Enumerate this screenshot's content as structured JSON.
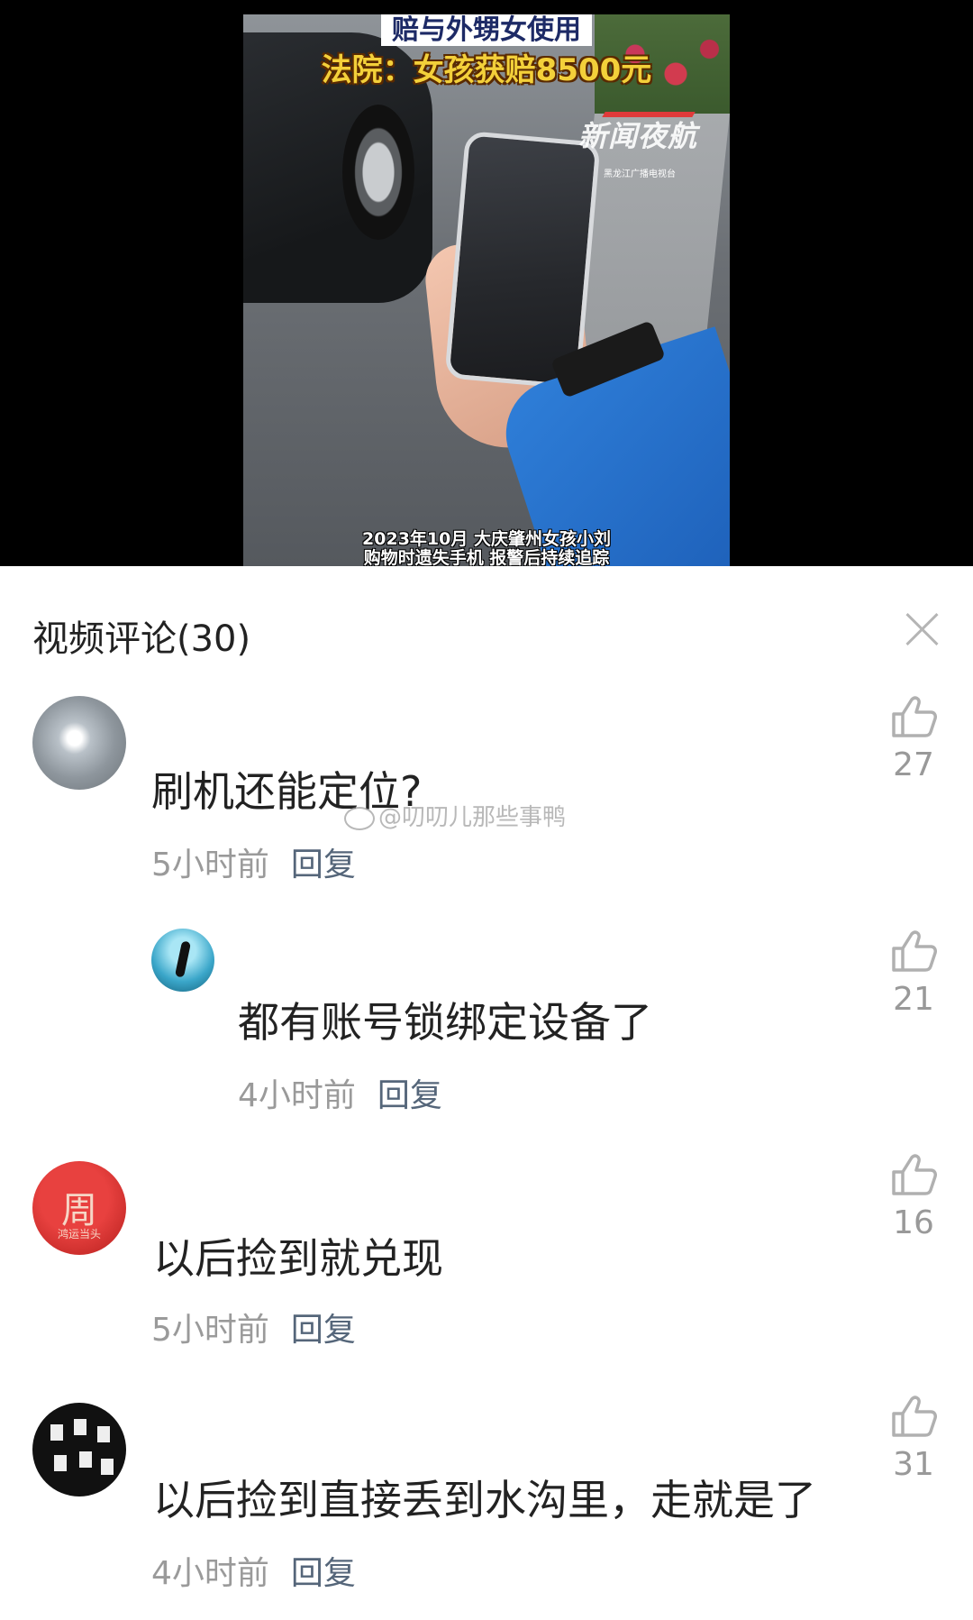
{
  "video": {
    "headline_top": "赔与外甥女使用",
    "headline_main": "法院：女孩获赔8500元",
    "logo": "新闻夜航",
    "logo_small": "黑龙江广播电视台",
    "caption_line1": "2023年10月 大庆肇州女孩小刘",
    "caption_line2": "购物时遗失手机 报警后持续追踪"
  },
  "comments_header": {
    "title": "视频评论(30)"
  },
  "watermark": "@叨叨儿那些事鸭",
  "comments": [
    {
      "text": "刷机还能定位?",
      "time": "5小时前",
      "reply": "回复",
      "likes": "27"
    },
    {
      "text": "都有账号锁绑定设备了",
      "time": "4小时前",
      "reply": "回复",
      "likes": "21"
    },
    {
      "text": "以后捡到就兑现",
      "time": "5小时前",
      "reply": "回复",
      "likes": "16"
    },
    {
      "text": "以后捡到直接丢到水沟里，走就是了",
      "time": "4小时前",
      "reply": "回复",
      "likes": "31"
    }
  ],
  "avatar3_glyph": "周",
  "avatar3_sub": "鸿运当头",
  "icons": [
    "close-icon",
    "thumbs-up-icon"
  ]
}
